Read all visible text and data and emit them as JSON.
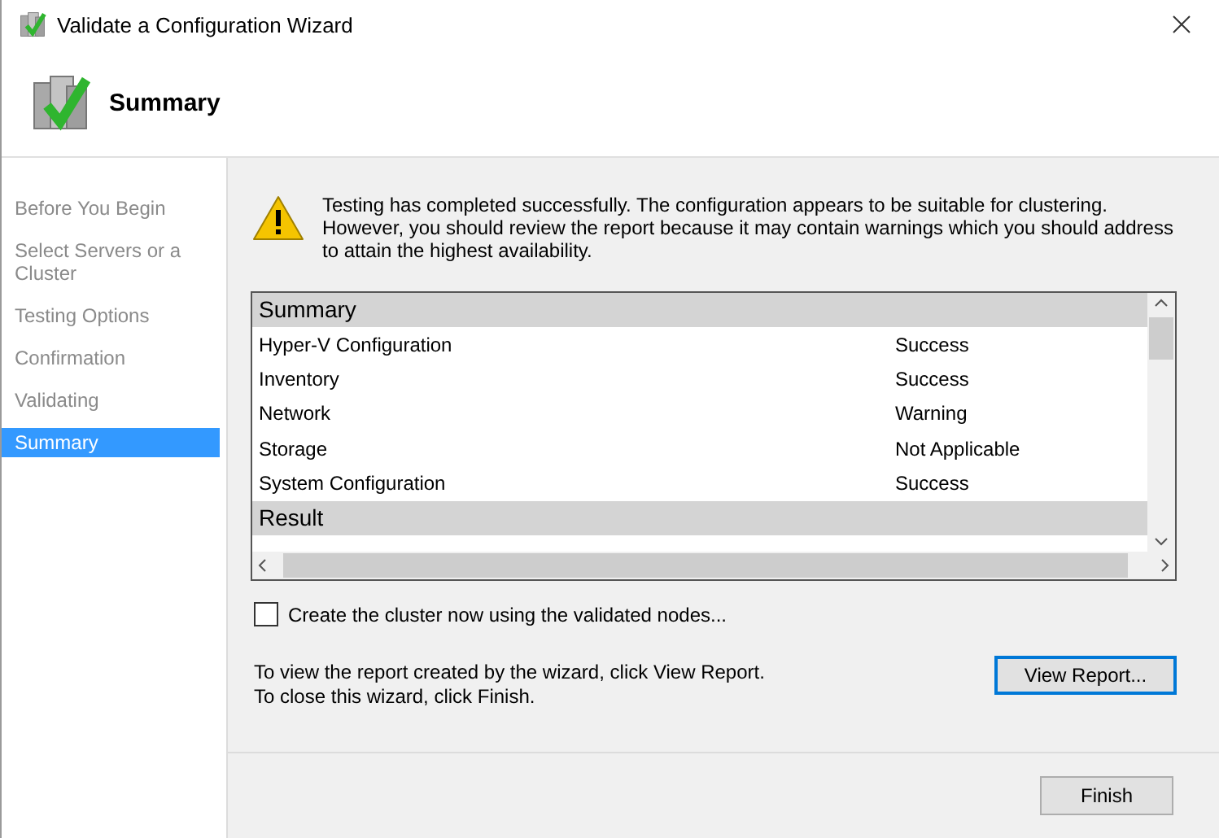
{
  "window": {
    "title": "Validate a Configuration Wizard"
  },
  "header": {
    "title": "Summary"
  },
  "sidebar": {
    "items": [
      {
        "label": "Before You Begin",
        "selected": false
      },
      {
        "label": "Select Servers or a Cluster",
        "selected": false
      },
      {
        "label": "Testing Options",
        "selected": false
      },
      {
        "label": "Confirmation",
        "selected": false
      },
      {
        "label": "Validating",
        "selected": false
      },
      {
        "label": "Summary",
        "selected": true
      }
    ]
  },
  "message": "Testing has completed successfully. The configuration appears to be suitable for clustering. However, you should review the report because it may contain warnings which you should address to attain the highest availability.",
  "report": [
    {
      "kind": "heading",
      "text": "Summary"
    },
    {
      "kind": "row",
      "name": "Hyper-V Configuration",
      "status": "Success"
    },
    {
      "kind": "row",
      "name": "Inventory",
      "status": "Success"
    },
    {
      "kind": "row",
      "name": "Network",
      "status": "Warning"
    },
    {
      "kind": "row",
      "name": "Storage",
      "status": "Not Applicable"
    },
    {
      "kind": "row",
      "name": "System Configuration",
      "status": "Success"
    },
    {
      "kind": "heading",
      "text": "Result"
    }
  ],
  "create_cluster": {
    "label": "Create the cluster now using the validated nodes...",
    "checked": false
  },
  "instructions": [
    "To view the report created by the wizard, click View Report.",
    "To close this wizard, click Finish."
  ],
  "view_report_button": {
    "label": "View Report...",
    "focused": true
  },
  "finish_button": {
    "label": "Finish"
  }
}
